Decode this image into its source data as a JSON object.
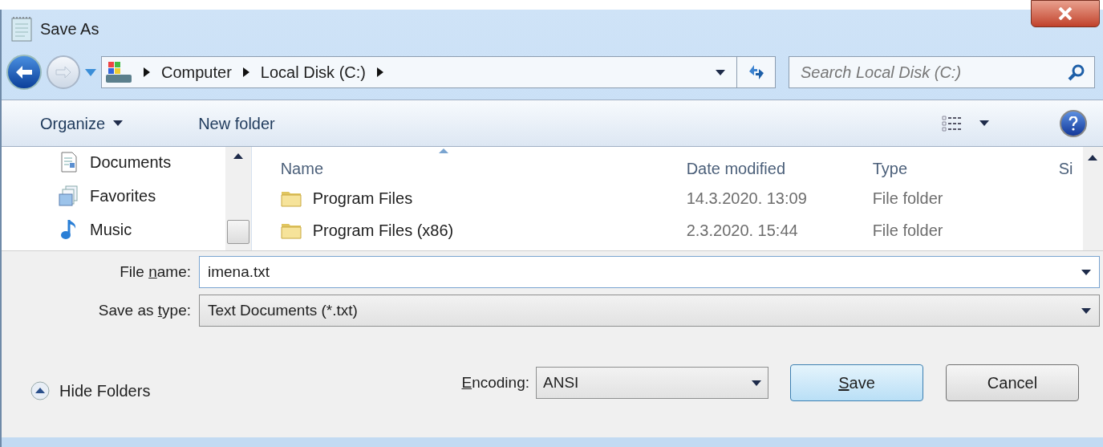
{
  "window": {
    "title": "Save As"
  },
  "address_bar": {
    "breadcrumbs": [
      "Computer",
      "Local Disk (C:)"
    ]
  },
  "search": {
    "placeholder": "Search Local Disk (C:)"
  },
  "toolbar": {
    "buttons": [
      {
        "label": "Organize",
        "kind": "menu"
      },
      {
        "label": "New folder",
        "kind": "plain"
      }
    ]
  },
  "sidebar": {
    "items": [
      {
        "label": "Documents",
        "kind": "document"
      },
      {
        "label": "Favorites",
        "kind": "favorites"
      },
      {
        "label": "Music",
        "kind": "music"
      }
    ]
  },
  "file_list": {
    "columns": [
      "Name",
      "Date modified",
      "Type",
      "Si"
    ],
    "rows": [
      {
        "name": "Program Files",
        "date_modified": "14.3.2020. 13:09",
        "type": "File folder"
      },
      {
        "name": "Program Files (x86)",
        "date_modified": "2.3.2020. 15:44",
        "type": "File folder"
      }
    ]
  },
  "form": {
    "file_name": {
      "label": {
        "before": "File ",
        "key": "n",
        "after": "ame:"
      },
      "value": "imena.txt"
    },
    "save_as_type": {
      "label": {
        "before": "Save as ",
        "key": "t",
        "after": "ype:"
      },
      "value": "Text Documents (*.txt)"
    }
  },
  "hide_folders": "Hide Folders",
  "encoding": {
    "label": {
      "key": "E",
      "after": "ncoding:"
    },
    "value": "ANSI"
  },
  "buttons": [
    {
      "label": {
        "key": "S",
        "after": "ave"
      },
      "default": true
    },
    {
      "label": {
        "before": "Cancel"
      },
      "default": false
    }
  ]
}
